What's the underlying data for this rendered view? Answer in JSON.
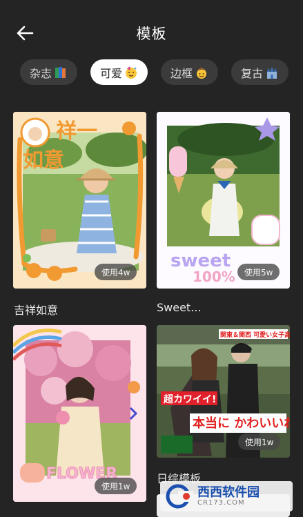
{
  "header": {
    "title": "模板"
  },
  "tabs": [
    {
      "label": "杂志",
      "icon": "books-emoji-icon",
      "active": false
    },
    {
      "label": "可爱",
      "icon": "party-face-emoji-icon",
      "active": true
    },
    {
      "label": "边框",
      "icon": "cowboy-face-emoji-icon",
      "active": false
    },
    {
      "label": "复古",
      "icon": "castle-emoji-icon",
      "active": false
    }
  ],
  "cards": [
    {
      "caption": "吉祥如意",
      "usage": "使用4w",
      "art_text": "祥一如意"
    },
    {
      "caption": "Sweet...",
      "usage": "使用5w",
      "art_text": "sweet 100%"
    },
    {
      "caption": "",
      "usage": "使用1w",
      "art_text": "FLOWER"
    },
    {
      "caption": "日综模板",
      "usage": "使用1w",
      "art_text_top": "関東＆関西 可愛い女子高生",
      "art_text_mid": "超カワイイ!",
      "art_text_bottom": "本当に かわいいね!"
    }
  ],
  "watermark": {
    "main": "西西软件园",
    "sub": "CR173.COM"
  }
}
